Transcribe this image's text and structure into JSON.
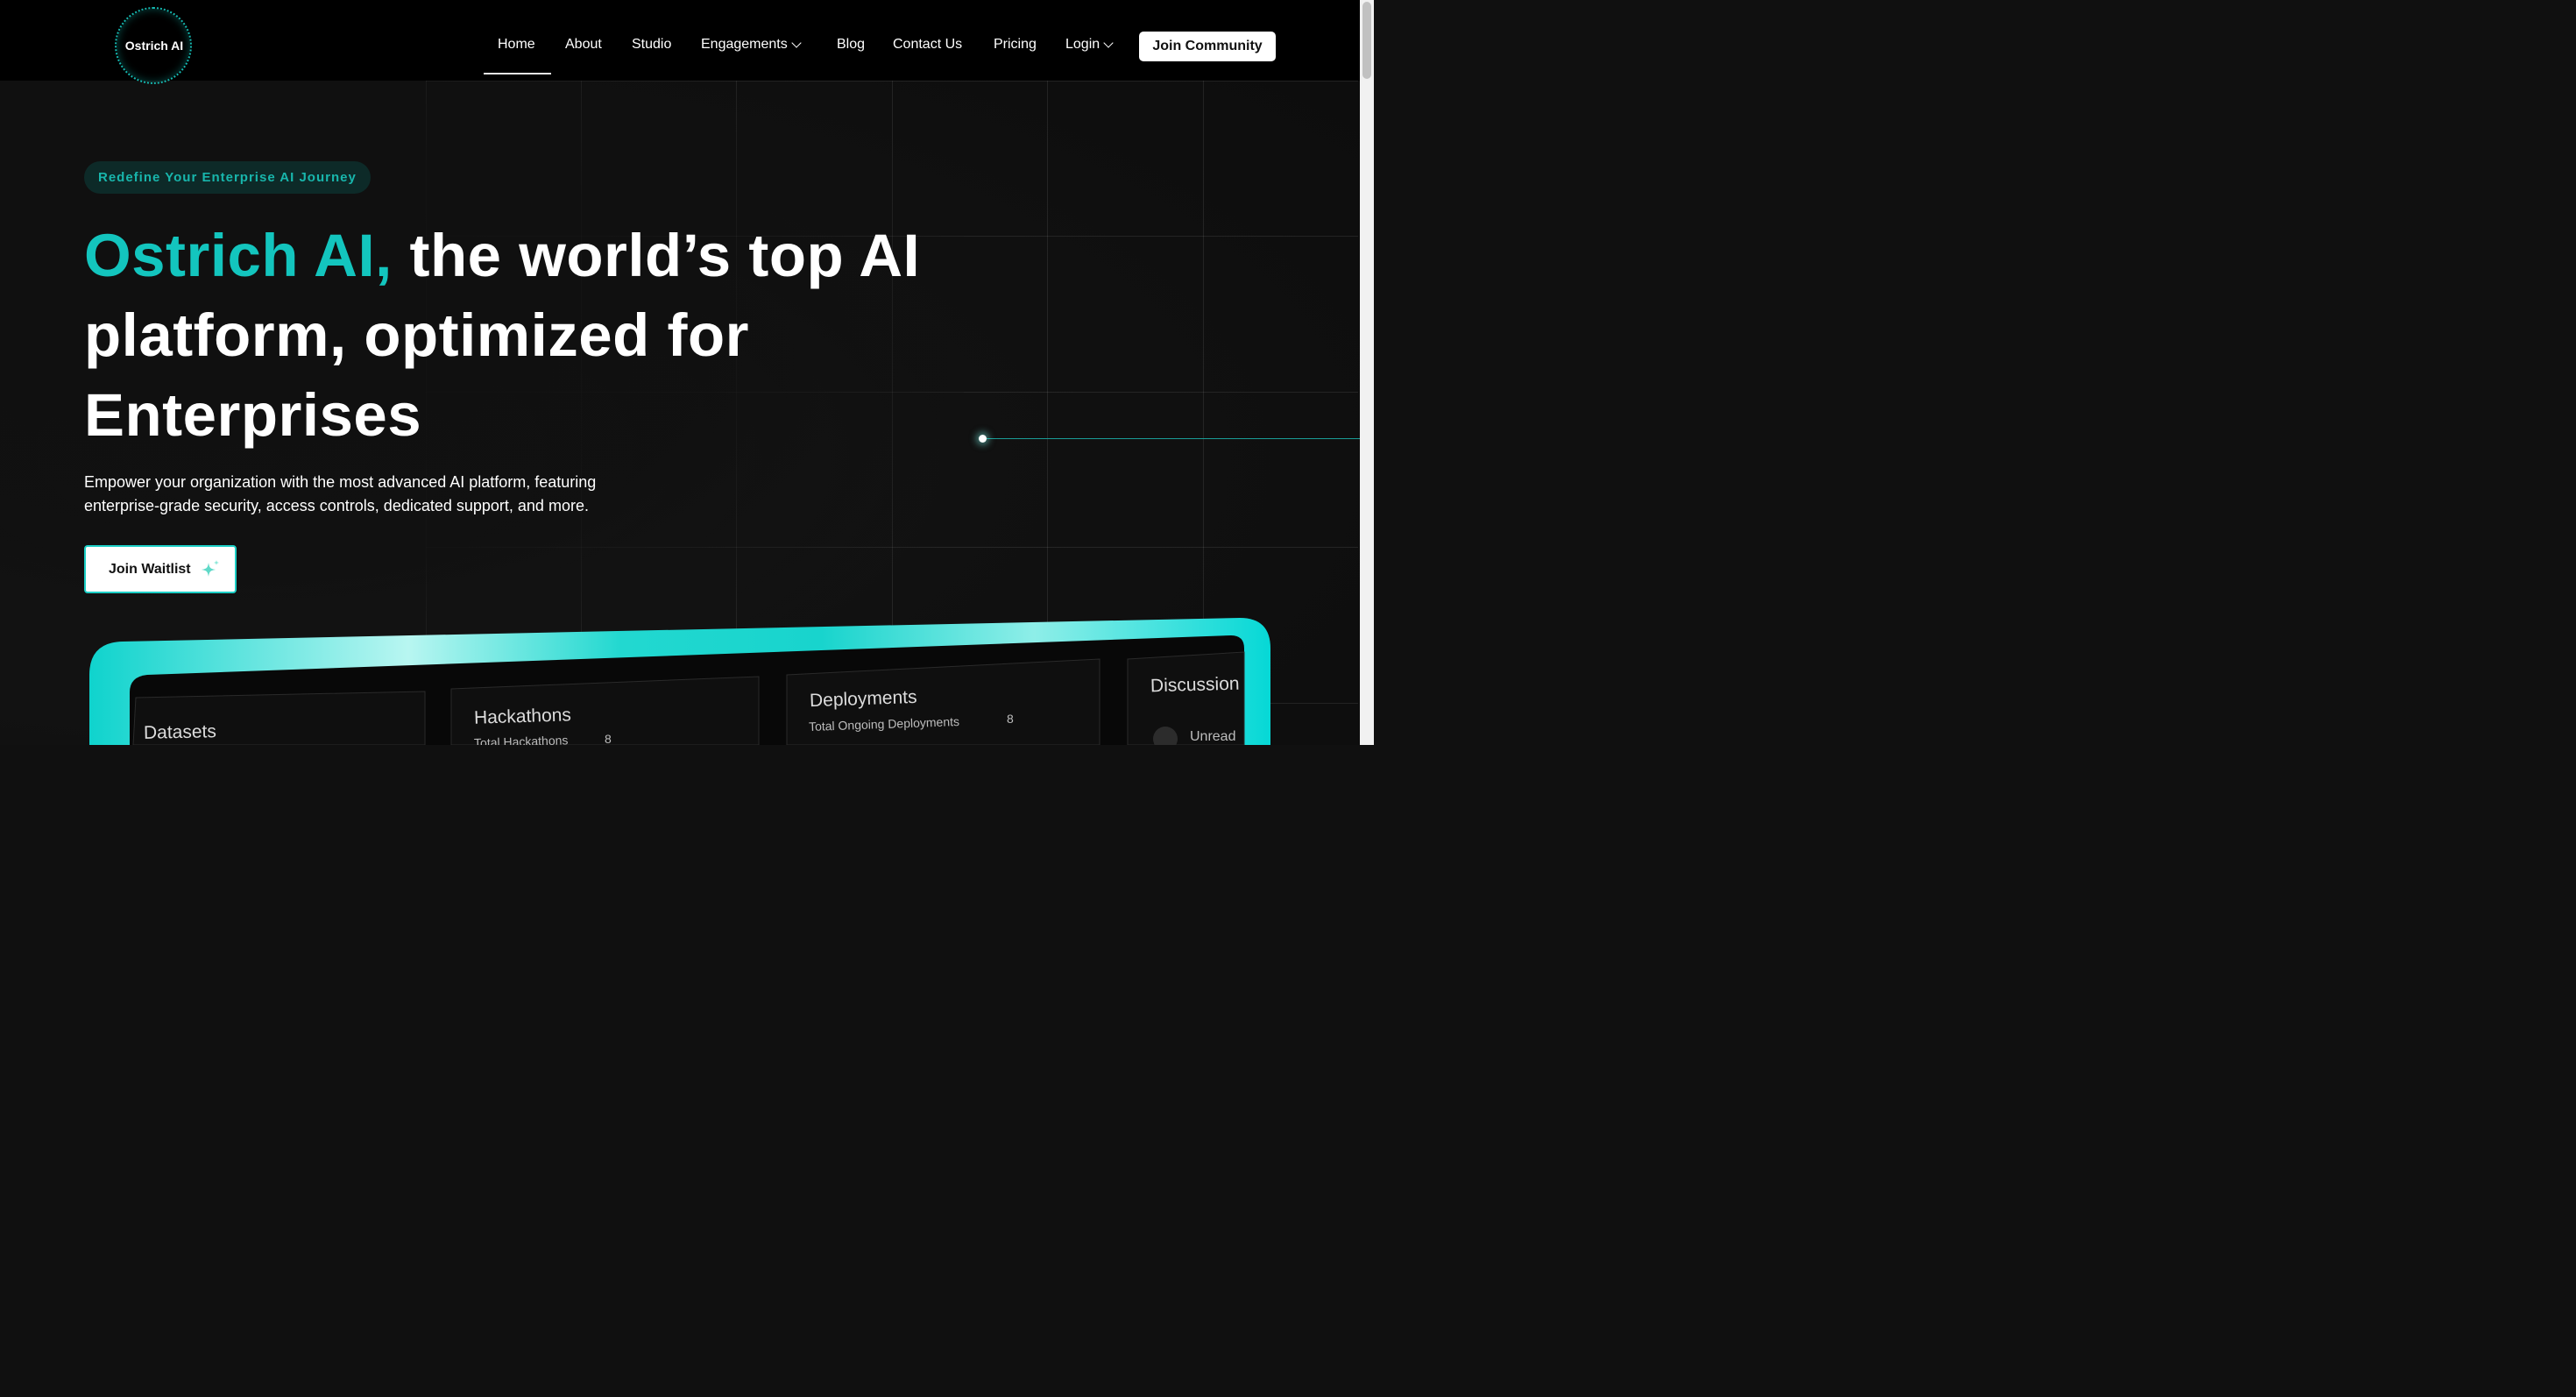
{
  "header": {
    "logo_text": "Ostrich AI",
    "nav": [
      {
        "label": "Home",
        "active": true
      },
      {
        "label": "About"
      },
      {
        "label": "Studio"
      },
      {
        "label": "Engagements",
        "dropdown": true
      },
      {
        "label": "Blog"
      },
      {
        "label": "Contact Us"
      },
      {
        "label": "Pricing"
      },
      {
        "label": "Login",
        "dropdown": true
      }
    ],
    "cta_label": "Join Community"
  },
  "hero": {
    "tagline": "Redefine Your Enterprise AI Journey",
    "headline_accent": "Ostrich AI,",
    "headline_rest_line1": " the world’s top AI",
    "headline_line2": "platform, optimized for",
    "headline_line3": "Enterprises",
    "description_line1": "Empower your organization with the most advanced AI platform, featuring",
    "description_line2": "enterprise-grade security, access controls, dedicated support, and more.",
    "cta_label": "Join Waitlist"
  },
  "preview": {
    "cards": [
      {
        "title": "Datasets"
      },
      {
        "title": "Hackathons",
        "stat_label": "Total Hackathons",
        "stat_value": "8"
      },
      {
        "title": "Deployments",
        "stat_label": "Total Ongoing Deployments",
        "stat_value": "8"
      },
      {
        "title": "Discussion",
        "stat_label": "Unread"
      }
    ]
  },
  "colors": {
    "accent": "#13c5be",
    "background": "#101010",
    "header_bg": "#000000"
  }
}
